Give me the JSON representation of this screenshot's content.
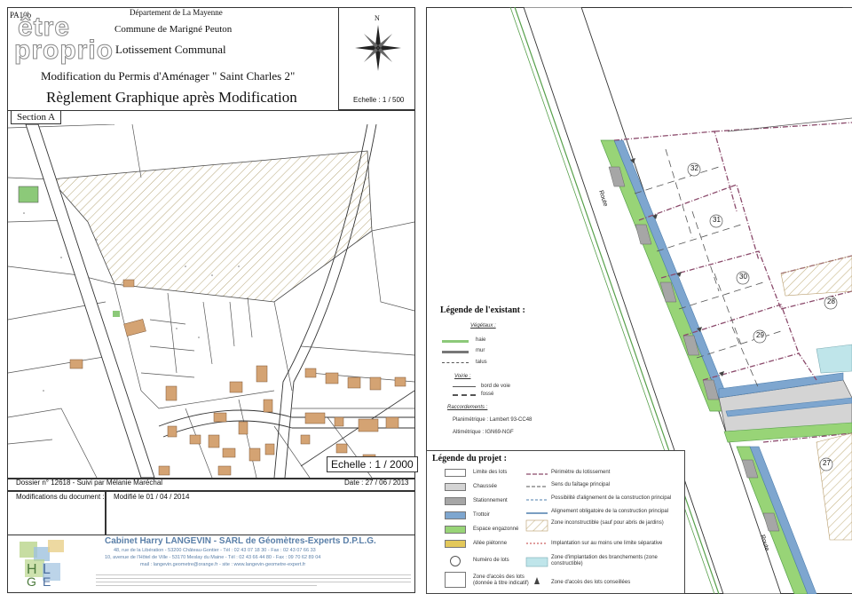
{
  "watermark": {
    "line1": "être",
    "line2": "proprio"
  },
  "page_tag": "PA10b",
  "header": {
    "department": "Département de La Mayenne",
    "commune": "Commune de Marigné Peuton",
    "lotissement": "Lotissement Communal",
    "modification": "Modification du Permis d'Aménager \" Saint Charles 2\"",
    "title": "Règlement Graphique après Modification",
    "scale_top": "Echelle : 1 / 500",
    "north": "N"
  },
  "left_map": {
    "section": "Section A",
    "scale": "Echelle : 1 / 2000"
  },
  "info": {
    "dossier": "Dossier n° 12618 - Suivi par Mélanie Maréchal",
    "date": "Date : 27 / 06 / 2013",
    "modif_label": "Modifications du document :",
    "modif_value": "Modifié le 01 / 04 / 2014"
  },
  "cabinet": {
    "name": "Cabinet Harry LANGEVIN - SARL de Géomètres-Experts D.P.L.G.",
    "line1": "48, rue de la Libération - 53200 Château-Gontier - Tél : 02 43 07 18 30 - Fax : 02 43 07 66 33",
    "line2": "10, avenue de l'Hôtel de Ville - 53170 Meslay du Maine - Tél : 02 43 66 44 80 - Fax : 09 70 62 89 04",
    "line3": "mail : langevin.geometre@orange.fr - site : www.langevin-geometre-expert.fr",
    "logo_letters": "HLGE"
  },
  "right_map": {
    "lots": [
      "32",
      "31",
      "30",
      "29",
      "28",
      "27"
    ],
    "road_label": "Route"
  },
  "legend_existant": {
    "title": "Légende de l'existant :",
    "vegetaux": "Végétaux :",
    "items_veg": [
      "haie",
      "mur",
      "talus"
    ],
    "voirie": "Voirie :",
    "items_voirie": [
      "bord de voie",
      "fossé"
    ],
    "raccordements": "Raccordements :",
    "planimetrique": "Planimétrique : Lambert 93-CC48",
    "altimetrique": "Altimétrique : IGN69-NGF"
  },
  "legend_projet": {
    "title": "Légende du projet :",
    "left": [
      {
        "label": "Limite des lots",
        "color": "#ffffff"
      },
      {
        "label": "Chaussée",
        "color": "#d4d4d4"
      },
      {
        "label": "Stationnement",
        "color": "#a6a6a6"
      },
      {
        "label": "Trottoir",
        "color": "#7ea6cf"
      },
      {
        "label": "Espace engazonné",
        "color": "#98d477"
      },
      {
        "label": "Allée piétonne",
        "color": "#e3c85a"
      },
      {
        "label": "Numéro de lots",
        "color": "none"
      },
      {
        "label": "Zone d'accès des lots (donnée à titre indicatif)",
        "color": "none"
      }
    ],
    "right": [
      "Périmètre du lotissement",
      "Sens du faîtage principal",
      "Possibilité d'alignement de la construction principal",
      "Alignement obligatoire de la construction principal",
      "Zone inconstructible (sauf pour abris de jardins)",
      "Implantation sur au moins une limite séparative",
      "Zone d'implantation des branchements (zone constructible)",
      "Zone d'accès des lots conseillées"
    ]
  },
  "colors": {
    "green": "#98d477",
    "blue": "#6f9ec9",
    "gray": "#a6a6a6",
    "road": "#d4d4d4",
    "lot_line": "#8b4a6b",
    "hatch": "#c8b78a"
  }
}
